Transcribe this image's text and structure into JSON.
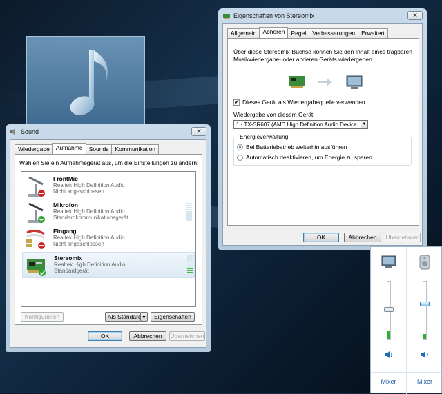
{
  "sound": {
    "title": "Sound",
    "close": "✕",
    "tabs": [
      "Wiedergabe",
      "Aufnahme",
      "Sounds",
      "Kommunikation"
    ],
    "instruction": "Wählen Sie ein Aufnahmegerät aus, um die Einstellungen zu ändern:",
    "devices": [
      {
        "name": "FrontMic",
        "driver": "Realtek High Definition Audio",
        "status": "Nicht angeschlossen",
        "icon": "microphone-icon",
        "badge": "unplugged",
        "meter_on": 0
      },
      {
        "name": "Mikrofon",
        "driver": "Realtek High Definition Audio",
        "status": "Standardkommunikationsgerät",
        "icon": "microphone-icon",
        "badge": "phone",
        "meter_on": 0
      },
      {
        "name": "Eingang",
        "driver": "Realtek High Definition Audio",
        "status": "Nicht angeschlossen",
        "icon": "line-in-icon",
        "badge": "unplugged",
        "meter_on": 0
      },
      {
        "name": "Stereomix",
        "driver": "Realtek High Definition Audio",
        "status": "Standardgerät",
        "icon": "sound-card-icon",
        "badge": "default",
        "meter_on": 3
      }
    ],
    "configure": "Konfigurieren",
    "set_default": "Als Standard",
    "properties": "Eigenschaften",
    "ok": "OK",
    "cancel": "Abbrechen",
    "apply": "Übernehmen"
  },
  "props": {
    "title": "Eigenschaften von Stereomix",
    "close": "✕",
    "tabs": [
      "Allgemein",
      "Abhören",
      "Pegel",
      "Verbesserungen",
      "Erweitert"
    ],
    "desc1": "Über diese Stereomix-Buchse können Sie den Inhalt eines tragbaren",
    "desc2": "Musikwiedergabe- oder anderen Geräts wiedergeben.",
    "listen_checkbox": "Dieses Gerät als Wiedergabequelle verwenden",
    "listen_checked": true,
    "playback_label": "Wiedergabe von diesem Gerät:",
    "playback_value": "1 - TX-SR607 (AMD High Definition Audio Device",
    "power_group": "Energieverwaltung",
    "radio1": "Bei Batteriebetrieb weiterhin ausführen",
    "radio2": "Automatisch deaktivieren, um Energie zu sparen",
    "selected_radio": 1,
    "ok": "OK",
    "cancel": "Abbrechen",
    "apply": "Übernehmen"
  },
  "mixer": {
    "channels": [
      {
        "icon": "monitor-speaker-icon",
        "level": 0.52,
        "label": "Mixer",
        "thumb": "gray"
      },
      {
        "icon": "system-sounds-icon",
        "level": 0.62,
        "label": "Mixer",
        "thumb": "blue"
      }
    ]
  }
}
